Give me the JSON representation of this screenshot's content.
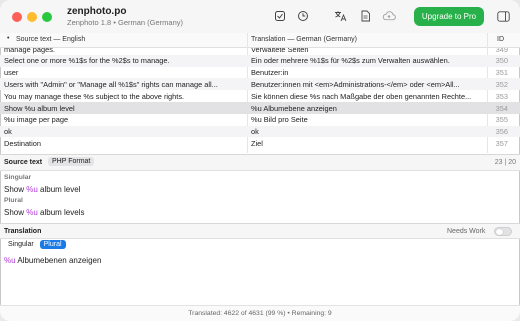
{
  "window": {
    "title": "zenphoto.po",
    "subtitle": "Zenphoto 1.8 • German (Germany)"
  },
  "toolbar": {
    "upgrade_label": "Upgrade to Pro",
    "icons": [
      "checkmark-square-icon",
      "clock-icon",
      "translate-icon",
      "document-icon",
      "cloud-upload-icon",
      "sidebar-toggle-icon"
    ]
  },
  "table": {
    "columns": {
      "source": "Source text — English",
      "translation": "Translation — German (Germany)",
      "id": "ID"
    },
    "rows": [
      {
        "source": "manage pages.",
        "translation": "Verwaltete Seiten",
        "id": "349"
      },
      {
        "source": "Select one or more %1$s for the %2$s to manage.",
        "translation": "Ein oder mehrere %1$s für  %2$s zum Verwalten auswählen.",
        "id": "350"
      },
      {
        "source": "user",
        "translation": "Benutzer:in",
        "id": "351"
      },
      {
        "source": "Users with \"Admin\" or \"Manage all %1$s\" rights can manage all...",
        "translation": "Benutzer:innen mit <em>Administrations-</em> oder <em>All...",
        "id": "352"
      },
      {
        "source": "You may manage these %s subject to the above rights.",
        "translation": "Sie können diese %s nach Maßgabe der oben genannten Rechte...",
        "id": "353"
      },
      {
        "source": "Show %u album level",
        "translation": "%u Albumebene anzeigen",
        "id": "354"
      },
      {
        "source": "%u image per page",
        "translation": "%u Bild pro Seite",
        "id": "355"
      },
      {
        "source": "ok",
        "translation": "ok",
        "id": "356"
      },
      {
        "source": "Destination",
        "translation": "Ziel",
        "id": "357"
      }
    ],
    "selected_index": 5
  },
  "source_panel": {
    "label": "Source text",
    "format_tab": "PHP Format",
    "counter": "23 | 20",
    "singular_label": "Singular",
    "singular_pre": "Show ",
    "singular_ph": "%u",
    "singular_post": " album level",
    "plural_label": "Plural",
    "plural_pre": "Show ",
    "plural_ph": "%u",
    "plural_post": " album levels"
  },
  "translation_panel": {
    "label": "Translation",
    "needs_work_label": "Needs Work",
    "tabs": [
      "Singular",
      "Plural"
    ],
    "active_tab": "Plural",
    "text_ph": "%u",
    "text_post": " Albumebenen anzeigen"
  },
  "status": {
    "text": "Translated: 4622 of 4631 (99 %)  •  Remaining: 9"
  },
  "colors": {
    "accent": "#1a7ae6",
    "upgrade": "#28b04a",
    "placeholder": "#b03ad8"
  }
}
